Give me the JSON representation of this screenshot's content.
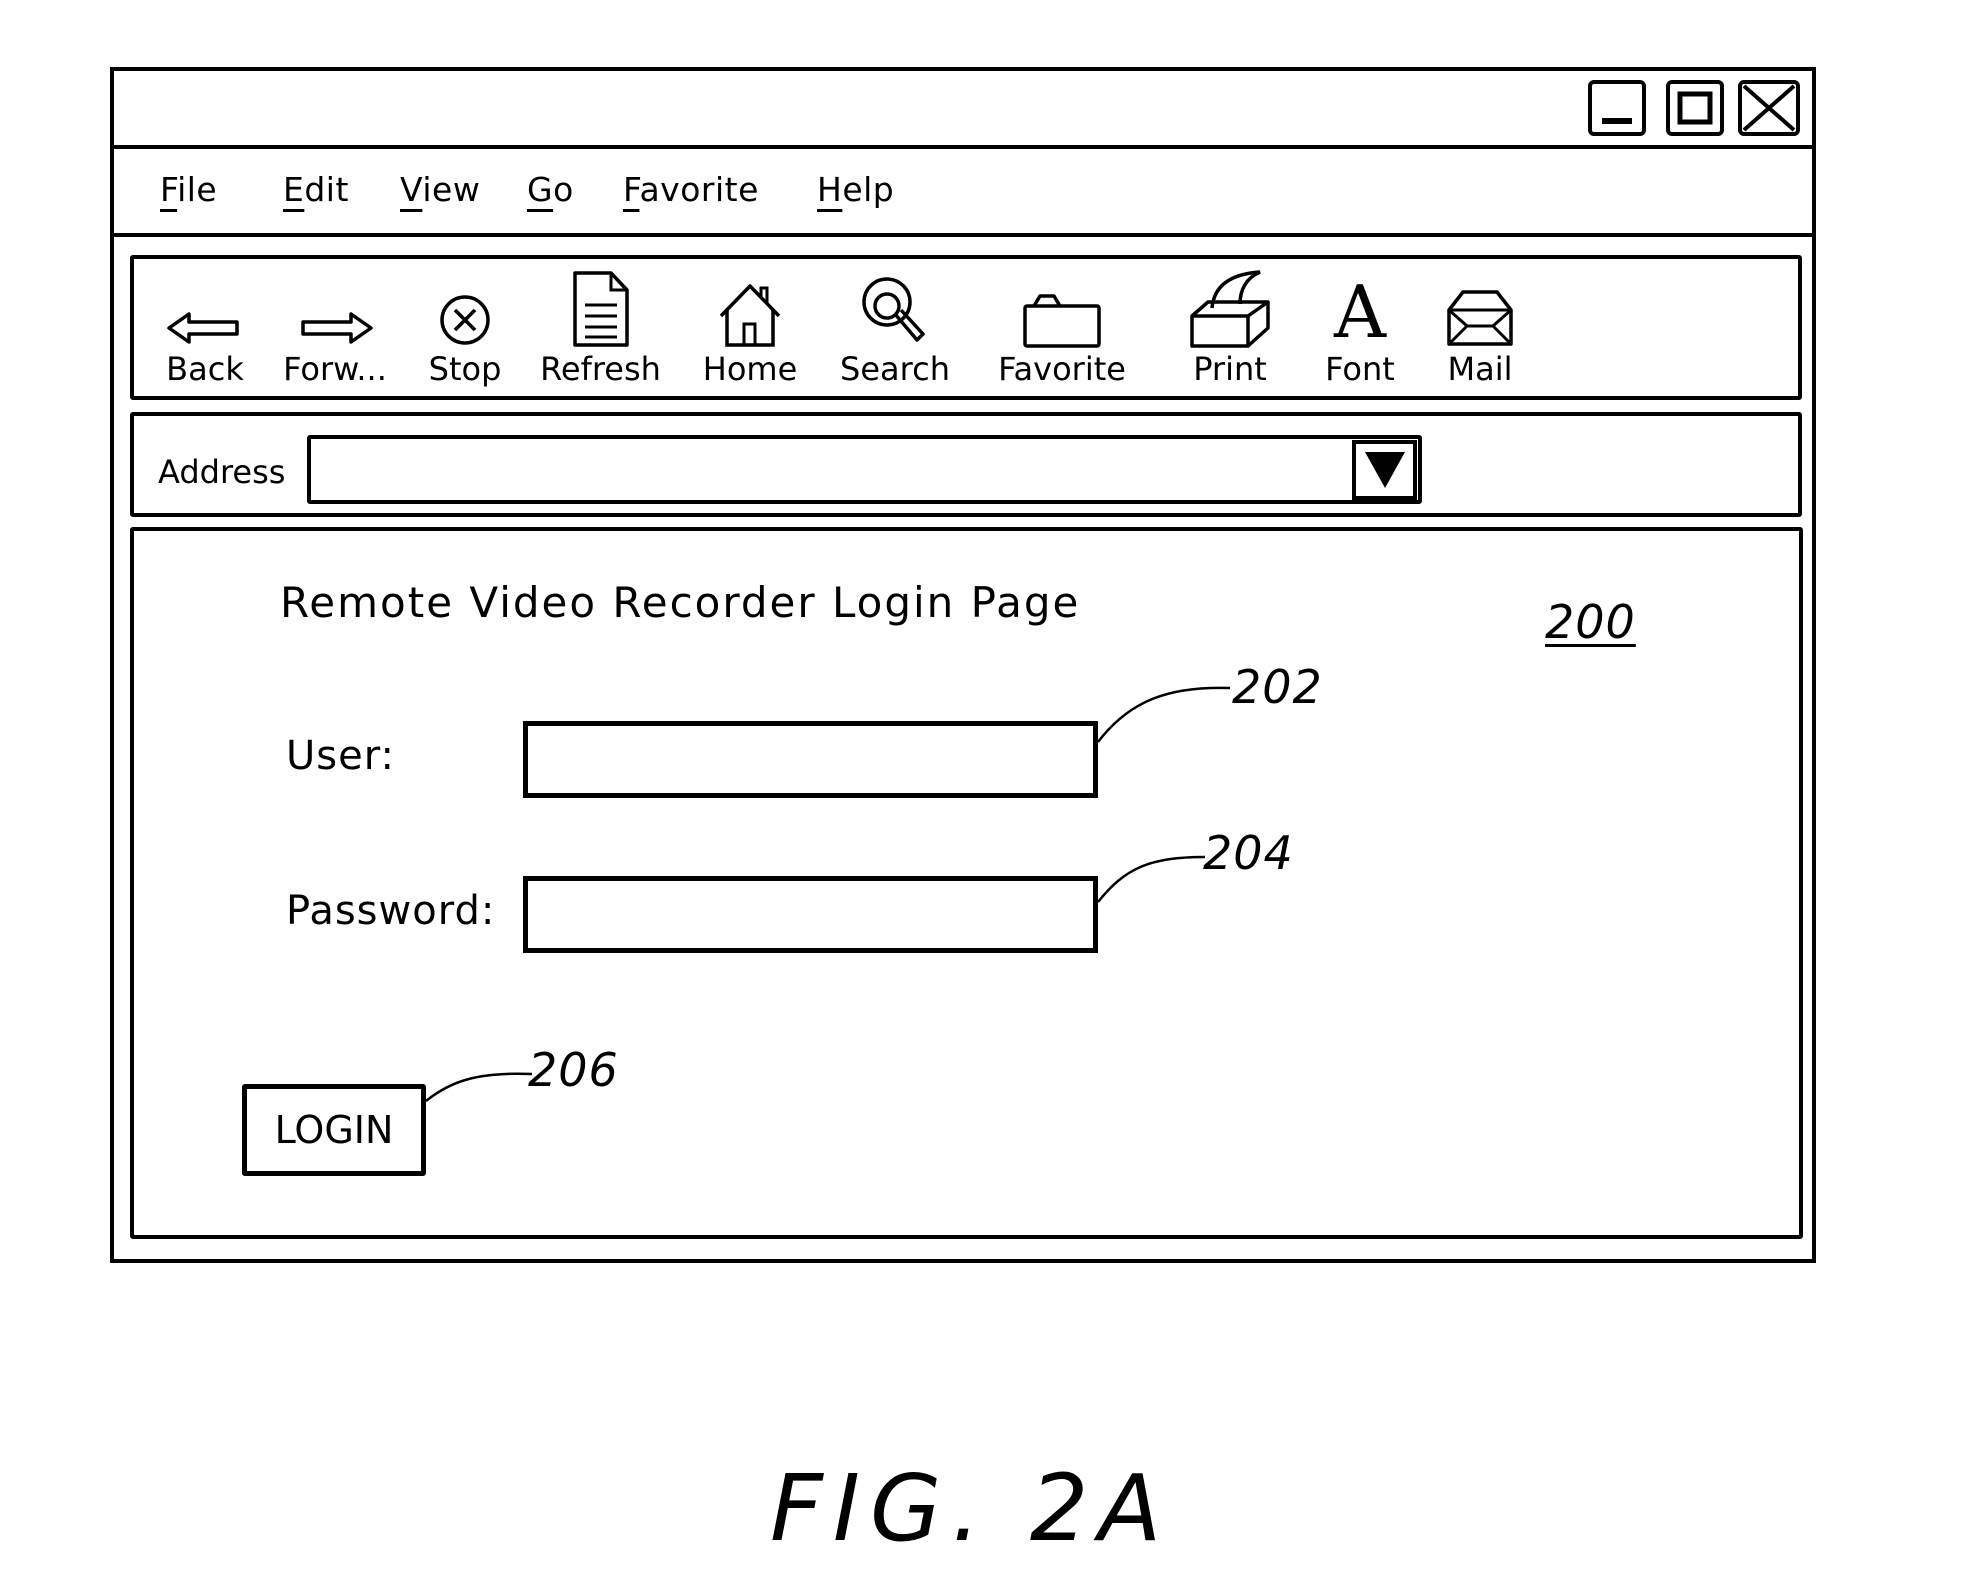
{
  "window": {
    "controls": [
      {
        "name": "minimize",
        "icon": "minimize-icon"
      },
      {
        "name": "maximize",
        "icon": "maximize-icon"
      },
      {
        "name": "close",
        "icon": "close-icon"
      }
    ]
  },
  "menu": {
    "items": [
      {
        "label": "File",
        "accel": "F",
        "rest": "ile"
      },
      {
        "label": "Edit",
        "accel": "E",
        "rest": "dit"
      },
      {
        "label": "View",
        "accel": "V",
        "rest": "iew"
      },
      {
        "label": "Go",
        "accel": "G",
        "rest": "o"
      },
      {
        "label": "Favorite",
        "accel": "F",
        "rest": "avorite"
      },
      {
        "label": "Help",
        "accel": "H",
        "rest": "elp"
      }
    ]
  },
  "toolbar": {
    "items": [
      {
        "label": "Back",
        "icon": "back-arrow-icon"
      },
      {
        "label": "Forw...",
        "icon": "forward-arrow-icon"
      },
      {
        "label": "Stop",
        "icon": "stop-icon"
      },
      {
        "label": "Refresh",
        "icon": "refresh-document-icon"
      },
      {
        "label": "Home",
        "icon": "home-icon"
      },
      {
        "label": "Search",
        "icon": "search-magnifier-icon"
      },
      {
        "label": "Favorite",
        "icon": "folder-icon"
      },
      {
        "label": "Print",
        "icon": "printer-icon"
      },
      {
        "label": "Font",
        "icon": "font-icon"
      },
      {
        "label": "Mail",
        "icon": "envelope-icon"
      }
    ]
  },
  "address": {
    "label": "Address",
    "value": "",
    "dropdown_icon": "dropdown-triangle-icon"
  },
  "page": {
    "title": "Remote Video Recorder Login Page",
    "ref_number": "200",
    "user_label": "User:",
    "user_value": "",
    "user_ref": "202",
    "password_label": "Password:",
    "password_value": "",
    "password_ref": "204",
    "login_label": "LOGIN",
    "login_ref": "206",
    "font_glyph": "A"
  },
  "figure": {
    "caption": "FIG. 2A"
  }
}
